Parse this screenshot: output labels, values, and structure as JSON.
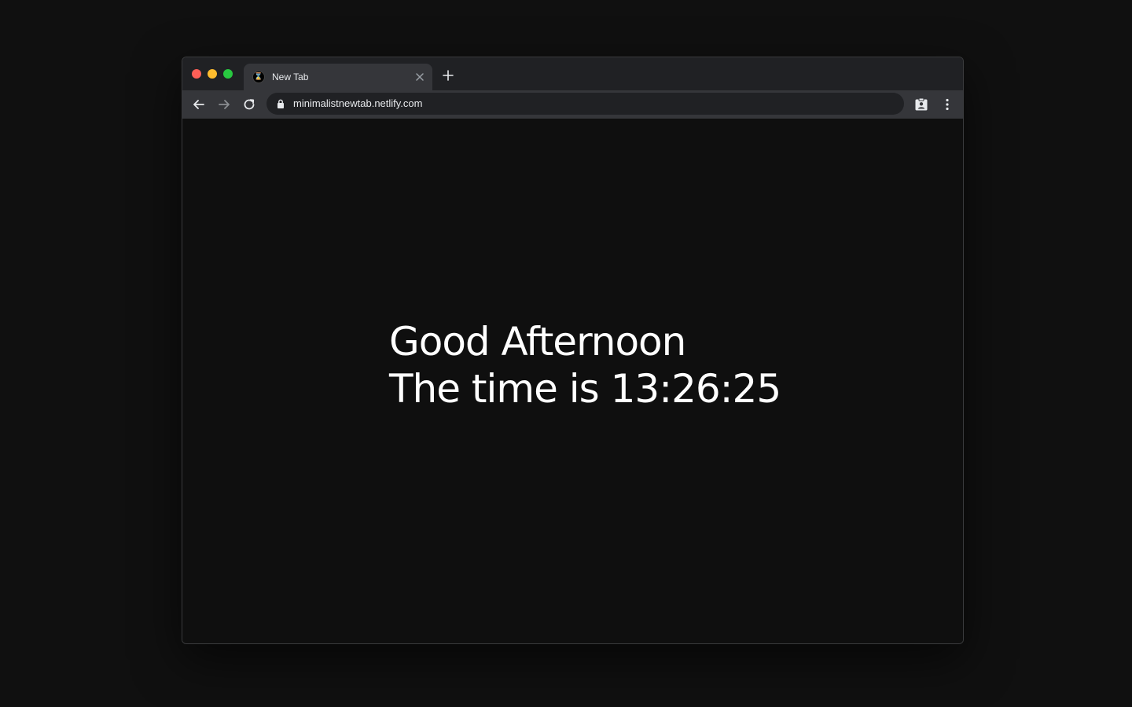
{
  "window": {
    "tab": {
      "title": "New Tab",
      "favicon_icon": "hourglass-icon"
    },
    "toolbar": {
      "url": "minimalistnewtab.netlify.com",
      "icons": [
        "back-arrow-icon",
        "forward-arrow-icon",
        "reload-icon",
        "lock-icon",
        "extension-badge-icon",
        "more-vert-icon"
      ]
    }
  },
  "page": {
    "greeting": "Good Afternoon",
    "time_prefix": "The time is",
    "time": "13:26:25"
  },
  "colors": {
    "background": "#101010",
    "text": "#ffffff",
    "close_dot": "#fe5f57",
    "minimize_dot": "#febc2e",
    "maximize_dot": "#28c840"
  }
}
